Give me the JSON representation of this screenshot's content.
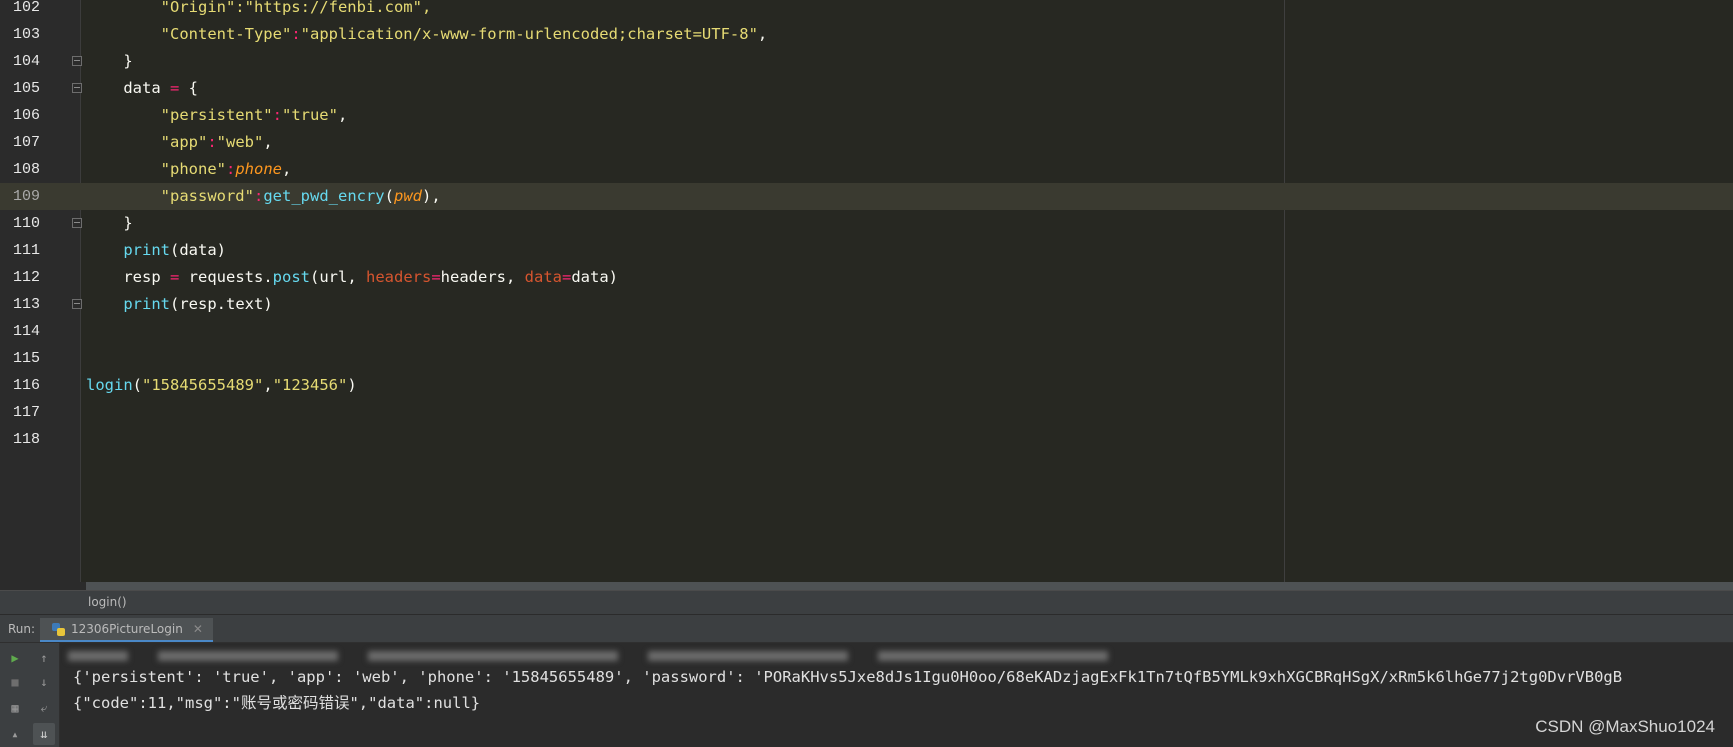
{
  "editor": {
    "lines": [
      {
        "num": "102",
        "tokens": [
          {
            "t": "        \"Origin\":\"https://fenbi.com\",",
            "c": "str"
          }
        ]
      },
      {
        "num": "103",
        "tokens": [
          {
            "t": "        ",
            "c": ""
          },
          {
            "t": "\"Content-Type\"",
            "c": "str"
          },
          {
            "t": ":",
            "c": "op"
          },
          {
            "t": "\"application/x-www-form-urlencoded;charset=UTF-8\"",
            "c": "str"
          },
          {
            "t": ",",
            "c": ""
          }
        ]
      },
      {
        "num": "104",
        "tokens": [
          {
            "t": "    }",
            "c": ""
          }
        ]
      },
      {
        "num": "105",
        "tokens": [
          {
            "t": "    data ",
            "c": ""
          },
          {
            "t": "=",
            "c": "op"
          },
          {
            "t": " {",
            "c": ""
          }
        ]
      },
      {
        "num": "106",
        "tokens": [
          {
            "t": "        ",
            "c": ""
          },
          {
            "t": "\"persistent\"",
            "c": "str"
          },
          {
            "t": ":",
            "c": "op"
          },
          {
            "t": "\"true\"",
            "c": "str"
          },
          {
            "t": ",",
            "c": ""
          }
        ]
      },
      {
        "num": "107",
        "tokens": [
          {
            "t": "        ",
            "c": ""
          },
          {
            "t": "\"app\"",
            "c": "str"
          },
          {
            "t": ":",
            "c": "op"
          },
          {
            "t": "\"web\"",
            "c": "str"
          },
          {
            "t": ",",
            "c": ""
          }
        ]
      },
      {
        "num": "108",
        "tokens": [
          {
            "t": "        ",
            "c": ""
          },
          {
            "t": "\"phone\"",
            "c": "str"
          },
          {
            "t": ":",
            "c": "op"
          },
          {
            "t": "phone",
            "c": "param"
          },
          {
            "t": ",",
            "c": ""
          }
        ]
      },
      {
        "num": "109",
        "current": true,
        "tokens": [
          {
            "t": "        ",
            "c": ""
          },
          {
            "t": "\"password\"",
            "c": "str"
          },
          {
            "t": ":",
            "c": "op"
          },
          {
            "t": "get_pwd_encry",
            "c": "fn"
          },
          {
            "t": "(",
            "c": ""
          },
          {
            "t": "pwd",
            "c": "param"
          },
          {
            "t": "),",
            "c": ""
          }
        ]
      },
      {
        "num": "110",
        "tokens": [
          {
            "t": "    }",
            "c": ""
          }
        ]
      },
      {
        "num": "111",
        "tokens": [
          {
            "t": "    ",
            "c": ""
          },
          {
            "t": "print",
            "c": "fn"
          },
          {
            "t": "(data)",
            "c": ""
          }
        ]
      },
      {
        "num": "112",
        "tokens": [
          {
            "t": "    resp ",
            "c": ""
          },
          {
            "t": "=",
            "c": "op"
          },
          {
            "t": " requests.",
            "c": ""
          },
          {
            "t": "post",
            "c": "fn"
          },
          {
            "t": "(url, ",
            "c": ""
          },
          {
            "t": "headers",
            "c": "kwarg"
          },
          {
            "t": "=",
            "c": "op"
          },
          {
            "t": "headers, ",
            "c": ""
          },
          {
            "t": "data",
            "c": "kwarg"
          },
          {
            "t": "=",
            "c": "op"
          },
          {
            "t": "data)",
            "c": ""
          }
        ]
      },
      {
        "num": "113",
        "tokens": [
          {
            "t": "    ",
            "c": ""
          },
          {
            "t": "print",
            "c": "fn"
          },
          {
            "t": "(resp.text)",
            "c": ""
          }
        ]
      },
      {
        "num": "114",
        "tokens": []
      },
      {
        "num": "115",
        "tokens": []
      },
      {
        "num": "116",
        "tokens": [
          {
            "t": "login",
            "c": "fn"
          },
          {
            "t": "(",
            "c": ""
          },
          {
            "t": "\"15845655489\"",
            "c": "str"
          },
          {
            "t": ",",
            "c": ""
          },
          {
            "t": "\"123456\"",
            "c": "str"
          },
          {
            "t": ")",
            "c": ""
          }
        ]
      },
      {
        "num": "117",
        "tokens": []
      },
      {
        "num": "118",
        "tokens": []
      }
    ]
  },
  "breadcrumb": "login()",
  "run_panel": {
    "label": "Run:",
    "tab_name": "12306PictureLogin",
    "output": [
      "{'persistent': 'true', 'app': 'web', 'phone': '15845655489', 'password': 'PORaKHvs5Jxe8dJs1Igu0H0oo/68eKADzjagExFk1Tn7tQfB5YMLk9xhXGCBRqHSgX/xRm5k6lhGe77j2tg0DvrVB0gB",
      "{\"code\":11,\"msg\":\"账号或密码错误\",\"data\":null}"
    ]
  },
  "watermark": "CSDN @MaxShuo1024",
  "colors": {
    "editor_bg": "#272822",
    "string": "#e6db74",
    "operator": "#f92672",
    "function": "#66d9ef",
    "parameter": "#fd971f",
    "kwarg": "#d6552f"
  }
}
